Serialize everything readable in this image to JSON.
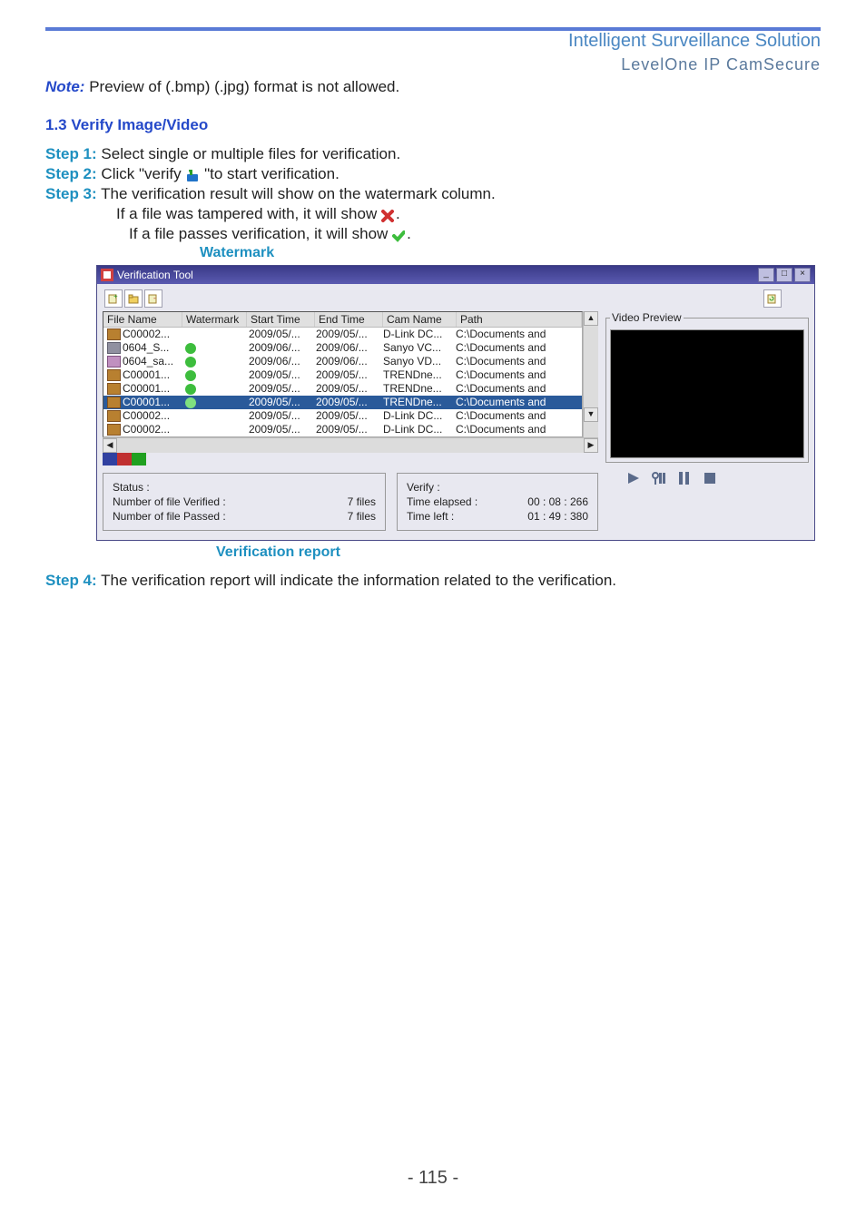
{
  "header": {
    "title": "Intelligent Surveillance Solution",
    "subtitle": "LevelOne IP CamSecure"
  },
  "note": {
    "label": "Note:",
    "text": "Preview of (.bmp) (.jpg) format is not allowed."
  },
  "section": {
    "verify_title": "1.3 Verify Image/Video"
  },
  "steps": {
    "s1_label": "Step 1:",
    "s1_text": "Select single or multiple files for verification.",
    "s2_label": "Step 2:",
    "s2_text_a": "Click \"verify",
    "s2_text_b": "\"to start verification.",
    "s3_label": "Step 3:",
    "s3_text": "The verification result will show on the watermark column.",
    "s3_line2": "If a file was tampered with, it will show",
    "s3_line3": "If a file passes verification, it will show",
    "s4_label": "Step 4:",
    "s4_text": "The verification report will indicate the information related to the verification."
  },
  "annotations": {
    "watermark": "Watermark",
    "verification_report": "Verification report"
  },
  "dialog": {
    "title": "Verification Tool",
    "video_preview_label": "Video Preview",
    "columns": [
      "File Name",
      "Watermark",
      "Start Time",
      "End Time",
      "Cam Name",
      "Path"
    ],
    "rows": [
      {
        "icon": "p",
        "name": "C00002...",
        "wm": "",
        "start": "2009/05/...",
        "end": "2009/05/...",
        "cam": "D-Link DC...",
        "path": "C:\\Documents and"
      },
      {
        "icon": "a",
        "name": "0604_S...",
        "wm": "ok",
        "start": "2009/06/...",
        "end": "2009/06/...",
        "cam": "Sanyo VC...",
        "path": "C:\\Documents and"
      },
      {
        "icon": "b",
        "name": "0604_sa...",
        "wm": "ok",
        "start": "2009/06/...",
        "end": "2009/06/...",
        "cam": "Sanyo VD...",
        "path": "C:\\Documents and"
      },
      {
        "icon": "p",
        "name": "C00001...",
        "wm": "ok",
        "start": "2009/05/...",
        "end": "2009/05/...",
        "cam": "TRENDne...",
        "path": "C:\\Documents and"
      },
      {
        "icon": "p",
        "name": "C00001...",
        "wm": "ok",
        "start": "2009/05/...",
        "end": "2009/05/...",
        "cam": "TRENDne...",
        "path": "C:\\Documents and"
      },
      {
        "icon": "p",
        "name": "C00001...",
        "wm": "ok",
        "start": "2009/05/...",
        "end": "2009/05/...",
        "cam": "TRENDne...",
        "path": "C:\\Documents and",
        "selected": true
      },
      {
        "icon": "p",
        "name": "C00002...",
        "wm": "",
        "start": "2009/05/...",
        "end": "2009/05/...",
        "cam": "D-Link DC...",
        "path": "C:\\Documents and"
      },
      {
        "icon": "p",
        "name": "C00002...",
        "wm": "",
        "start": "2009/05/...",
        "end": "2009/05/...",
        "cam": "D-Link DC...",
        "path": "C:\\Documents and"
      }
    ],
    "status": {
      "heading": "Status :",
      "verified_label": "Number of file Verified :",
      "verified_value": "7  files",
      "passed_label": "Number of file Passed :",
      "passed_value": "7  files"
    },
    "verify": {
      "heading": "Verify :",
      "elapsed_label": "Time elapsed :",
      "elapsed_value": "00 : 08 : 266",
      "left_label": "Time left :",
      "left_value": "01 : 49 : 380"
    }
  },
  "page_number": "- 115 -"
}
